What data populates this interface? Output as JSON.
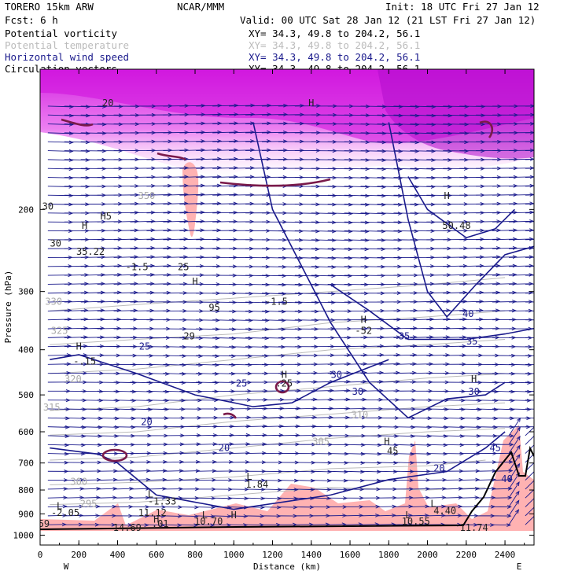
{
  "header": {
    "model": "TORERO  15km ARW",
    "org": "NCAR/MMM",
    "init": "Init: 18 UTC Fri 27 Jan 12",
    "fcst": "Fcst:    6 h",
    "valid": "Valid: 00 UTC Sat 28 Jan 12 (21 LST Fri 27 Jan 12)",
    "fields": [
      {
        "name": "Potential vorticity",
        "xy": "XY=  34.3, 49.8 to 204.2, 56.1",
        "color": "#000000"
      },
      {
        "name": "Potential temperature",
        "xy": "XY=  34.3, 49.8 to 204.2, 56.1",
        "color": "#bbbbbb"
      },
      {
        "name": "Horizontal wind speed",
        "xy": "XY=  34.3, 49.8 to 204.2, 56.1",
        "color": "#1a1a8c"
      },
      {
        "name": "Circulation vectors",
        "xy": "XY=  34.3, 49.8 to 204.2, 56.1",
        "color": "#000000"
      }
    ]
  },
  "chart_data": {
    "type": "contour",
    "xlabel": "Distance (km)",
    "ylabel": "Pressure (hPa)",
    "xlim": [
      0,
      2550
    ],
    "ylim": [
      1050,
      100
    ],
    "xticks": [
      0,
      200,
      400,
      600,
      800,
      1000,
      1200,
      1400,
      1600,
      1800,
      2000,
      2200,
      2400
    ],
    "yticks": [
      200,
      300,
      400,
      500,
      600,
      700,
      800,
      900,
      1000
    ],
    "y_scale": "log",
    "x_end_labels": {
      "left": "W",
      "right": "E"
    },
    "colors": {
      "pv_fill": "#e040e8",
      "pv_low_fill": "#ffaaaa",
      "wind": "#1a1a8c",
      "theta": "#bbbbbb",
      "pv_line": "#7a1a4a"
    },
    "wind_contours": [
      {
        "value": 20,
        "points": [
          [
            50,
            650
          ],
          [
            300,
            670
          ],
          [
            400,
            700
          ],
          [
            600,
            820
          ],
          [
            1000,
            880
          ],
          [
            1500,
            820
          ],
          [
            1800,
            760
          ],
          [
            2100,
            730
          ],
          [
            2300,
            650
          ],
          [
            2400,
            600
          ]
        ]
      },
      {
        "value": 25,
        "points": [
          [
            50,
            420
          ],
          [
            200,
            410
          ],
          [
            500,
            450
          ],
          [
            800,
            500
          ],
          [
            1100,
            530
          ],
          [
            1300,
            520
          ],
          [
            1500,
            470
          ],
          [
            1800,
            420
          ]
        ]
      },
      {
        "value": 30,
        "points": [
          [
            1100,
            130
          ],
          [
            1200,
            200
          ],
          [
            1500,
            350
          ],
          [
            1700,
            470
          ],
          [
            1900,
            560
          ],
          [
            2100,
            510
          ],
          [
            2300,
            500
          ],
          [
            2400,
            470
          ]
        ]
      },
      {
        "value": 35,
        "points": [
          [
            1500,
            290
          ],
          [
            1700,
            330
          ],
          [
            1900,
            380
          ],
          [
            2200,
            380
          ],
          [
            2400,
            370
          ],
          [
            2550,
            360
          ]
        ]
      },
      {
        "value": 40,
        "points": [
          [
            1800,
            130
          ],
          [
            1900,
            210
          ],
          [
            2000,
            300
          ],
          [
            2100,
            340
          ],
          [
            2250,
            290
          ],
          [
            2400,
            250
          ],
          [
            2550,
            240
          ]
        ]
      },
      {
        "value": 45,
        "points": [
          [
            1900,
            170
          ],
          [
            2000,
            200
          ],
          [
            2200,
            230
          ],
          [
            2350,
            220
          ],
          [
            2450,
            200
          ]
        ]
      }
    ],
    "theta_contours": [
      {
        "value": 295,
        "points": [
          [
            50,
            860
          ],
          [
            500,
            850
          ],
          [
            1000,
            820
          ],
          [
            1500,
            790
          ],
          [
            2000,
            800
          ],
          [
            2300,
            790
          ]
        ]
      },
      {
        "value": 300,
        "points": [
          [
            50,
            780
          ],
          [
            500,
            770
          ],
          [
            1000,
            750
          ],
          [
            1500,
            720
          ],
          [
            2000,
            710
          ],
          [
            2300,
            690
          ]
        ]
      },
      {
        "value": 305,
        "points": [
          [
            50,
            690
          ],
          [
            500,
            680
          ],
          [
            1000,
            650
          ],
          [
            1500,
            620
          ],
          [
            2000,
            600
          ],
          [
            2400,
            590
          ]
        ]
      },
      {
        "value": 310,
        "points": [
          [
            50,
            610
          ],
          [
            500,
            600
          ],
          [
            1000,
            570
          ],
          [
            1500,
            550
          ],
          [
            2000,
            530
          ],
          [
            2400,
            520
          ]
        ]
      },
      {
        "value": 315,
        "points": [
          [
            50,
            540
          ],
          [
            500,
            530
          ],
          [
            1000,
            500
          ],
          [
            1500,
            480
          ],
          [
            2000,
            460
          ],
          [
            2400,
            450
          ]
        ]
      },
      {
        "value": 320,
        "points": [
          [
            50,
            450
          ],
          [
            500,
            440
          ],
          [
            1000,
            420
          ],
          [
            1500,
            400
          ],
          [
            2000,
            390
          ],
          [
            2400,
            380
          ]
        ]
      },
      {
        "value": 325,
        "points": [
          [
            50,
            390
          ],
          [
            500,
            380
          ],
          [
            1000,
            370
          ],
          [
            1500,
            350
          ],
          [
            2000,
            340
          ],
          [
            2400,
            330
          ]
        ]
      },
      {
        "value": 330,
        "points": [
          [
            50,
            330
          ],
          [
            500,
            320
          ],
          [
            1000,
            310
          ],
          [
            1500,
            300
          ],
          [
            2000,
            290
          ],
          [
            2400,
            280
          ]
        ]
      }
    ],
    "contour_labels": [
      {
        "text": "20",
        "x": 550,
        "y": 580,
        "kind": "wind"
      },
      {
        "text": "20",
        "x": 950,
        "y": 660,
        "kind": "wind"
      },
      {
        "text": "20",
        "x": 2060,
        "y": 730,
        "kind": "wind"
      },
      {
        "text": "25",
        "x": 540,
        "y": 400,
        "kind": "wind"
      },
      {
        "text": "25",
        "x": 1040,
        "y": 480,
        "kind": "wind"
      },
      {
        "text": "30",
        "x": 1530,
        "y": 460,
        "kind": "wind"
      },
      {
        "text": "30",
        "x": 1640,
        "y": 500,
        "kind": "wind"
      },
      {
        "text": "30",
        "x": 2240,
        "y": 500,
        "kind": "wind"
      },
      {
        "text": "35",
        "x": 1880,
        "y": 380,
        "kind": "wind"
      },
      {
        "text": "35",
        "x": 2230,
        "y": 390,
        "kind": "wind"
      },
      {
        "text": "40",
        "x": 2210,
        "y": 340,
        "kind": "wind"
      },
      {
        "text": "40",
        "x": 2410,
        "y": 770,
        "kind": "wind"
      },
      {
        "text": "45",
        "x": 2350,
        "y": 660,
        "kind": "wind"
      },
      {
        "text": "305",
        "x": 1450,
        "y": 640,
        "kind": "theta"
      },
      {
        "text": "310",
        "x": 1650,
        "y": 560,
        "kind": "theta"
      },
      {
        "text": "315",
        "x": 60,
        "y": 540,
        "kind": "theta"
      },
      {
        "text": "320",
        "x": 170,
        "y": 470,
        "kind": "theta"
      },
      {
        "text": "325",
        "x": 100,
        "y": 370,
        "kind": "theta"
      },
      {
        "text": "330",
        "x": 70,
        "y": 320,
        "kind": "theta"
      },
      {
        "text": "350",
        "x": 550,
        "y": 190,
        "kind": "theta"
      },
      {
        "text": "295",
        "x": 250,
        "y": 870,
        "kind": "theta"
      },
      {
        "text": "300",
        "x": 200,
        "y": 780,
        "kind": "theta"
      }
    ],
    "extrema": [
      {
        "text": "H",
        "x": 200,
        "y": 400,
        "kind": "pv"
      },
      {
        "text": "-.15",
        "x": 230,
        "y": 430,
        "kind": "pv"
      },
      {
        "text": "H",
        "x": 1260,
        "y": 460,
        "kind": "pv"
      },
      {
        "text": ".25",
        "x": 1260,
        "y": 480,
        "kind": "pv"
      },
      {
        "text": "L",
        "x": 1080,
        "y": 760,
        "kind": "pv"
      },
      {
        "text": "1.84",
        "x": 1120,
        "y": 790,
        "kind": "pv"
      },
      {
        "text": "L",
        "x": 570,
        "y": 830,
        "kind": "pv"
      },
      {
        "text": "-1.33",
        "x": 630,
        "y": 860,
        "kind": "pv"
      },
      {
        "text": "L",
        "x": 100,
        "y": 880,
        "kind": "pv"
      },
      {
        "text": "-2.05",
        "x": 130,
        "y": 910,
        "kind": "pv"
      },
      {
        "text": "11.12",
        "x": 580,
        "y": 910,
        "kind": "pv"
      },
      {
        "text": "H",
        "x": 600,
        "y": 940,
        "kind": "pv"
      },
      {
        "text": ".01",
        "x": 620,
        "y": 960,
        "kind": "pv"
      },
      {
        "text": "L",
        "x": 850,
        "y": 920,
        "kind": "pv"
      },
      {
        "text": "H",
        "x": 1000,
        "y": 920,
        "kind": "pv"
      },
      {
        "text": "10.70",
        "x": 870,
        "y": 950,
        "kind": "pv"
      },
      {
        "text": "L",
        "x": 1900,
        "y": 920,
        "kind": "pv"
      },
      {
        "text": "10.55",
        "x": 1940,
        "y": 950,
        "kind": "pv"
      },
      {
        "text": "L",
        "x": 2030,
        "y": 870,
        "kind": "pv"
      },
      {
        "text": "4.40",
        "x": 2090,
        "y": 900,
        "kind": "pv"
      },
      {
        "text": "14.69",
        "x": 450,
        "y": 980,
        "kind": "pv"
      },
      {
        "text": "11.74",
        "x": 2240,
        "y": 980,
        "kind": "pv"
      },
      {
        "text": "59",
        "x": 20,
        "y": 960,
        "kind": "pv"
      },
      {
        "text": "H",
        "x": 1400,
        "y": 120,
        "kind": "pv"
      },
      {
        "text": "H",
        "x": 2100,
        "y": 190,
        "kind": "pv"
      },
      {
        "text": "50.48",
        "x": 2150,
        "y": 220,
        "kind": "pv"
      },
      {
        "text": "H",
        "x": 230,
        "y": 220,
        "kind": "pv"
      },
      {
        "text": "35.22",
        "x": 260,
        "y": 250,
        "kind": "pv"
      },
      {
        "text": "-1.5",
        "x": 500,
        "y": 270,
        "kind": "pv"
      },
      {
        "text": "-1.5",
        "x": 1220,
        "y": 320,
        "kind": "pv"
      },
      {
        "text": "H",
        "x": 800,
        "y": 290,
        "kind": "pv"
      },
      {
        "text": "95",
        "x": 900,
        "y": 330,
        "kind": "pv"
      },
      {
        "text": "H",
        "x": 1670,
        "y": 350,
        "kind": "pv"
      },
      {
        "text": "-52",
        "x": 1670,
        "y": 370,
        "kind": "pv"
      },
      {
        "text": "H",
        "x": 2240,
        "y": 470,
        "kind": "pv"
      },
      {
        "text": "H",
        "x": 1790,
        "y": 640,
        "kind": "pv"
      },
      {
        "text": "45",
        "x": 1820,
        "y": 670,
        "kind": "pv"
      },
      {
        "text": "20",
        "x": 350,
        "y": 120,
        "kind": "pv"
      },
      {
        "text": "30",
        "x": 40,
        "y": 200,
        "kind": "pv"
      },
      {
        "text": "30",
        "x": 80,
        "y": 240,
        "kind": "pv"
      },
      {
        "text": "25",
        "x": 740,
        "y": 270,
        "kind": "pv"
      },
      {
        "text": "29",
        "x": 770,
        "y": 380,
        "kind": "pv"
      },
      {
        "text": "H5",
        "x": 340,
        "y": 210,
        "kind": "pv"
      }
    ]
  }
}
